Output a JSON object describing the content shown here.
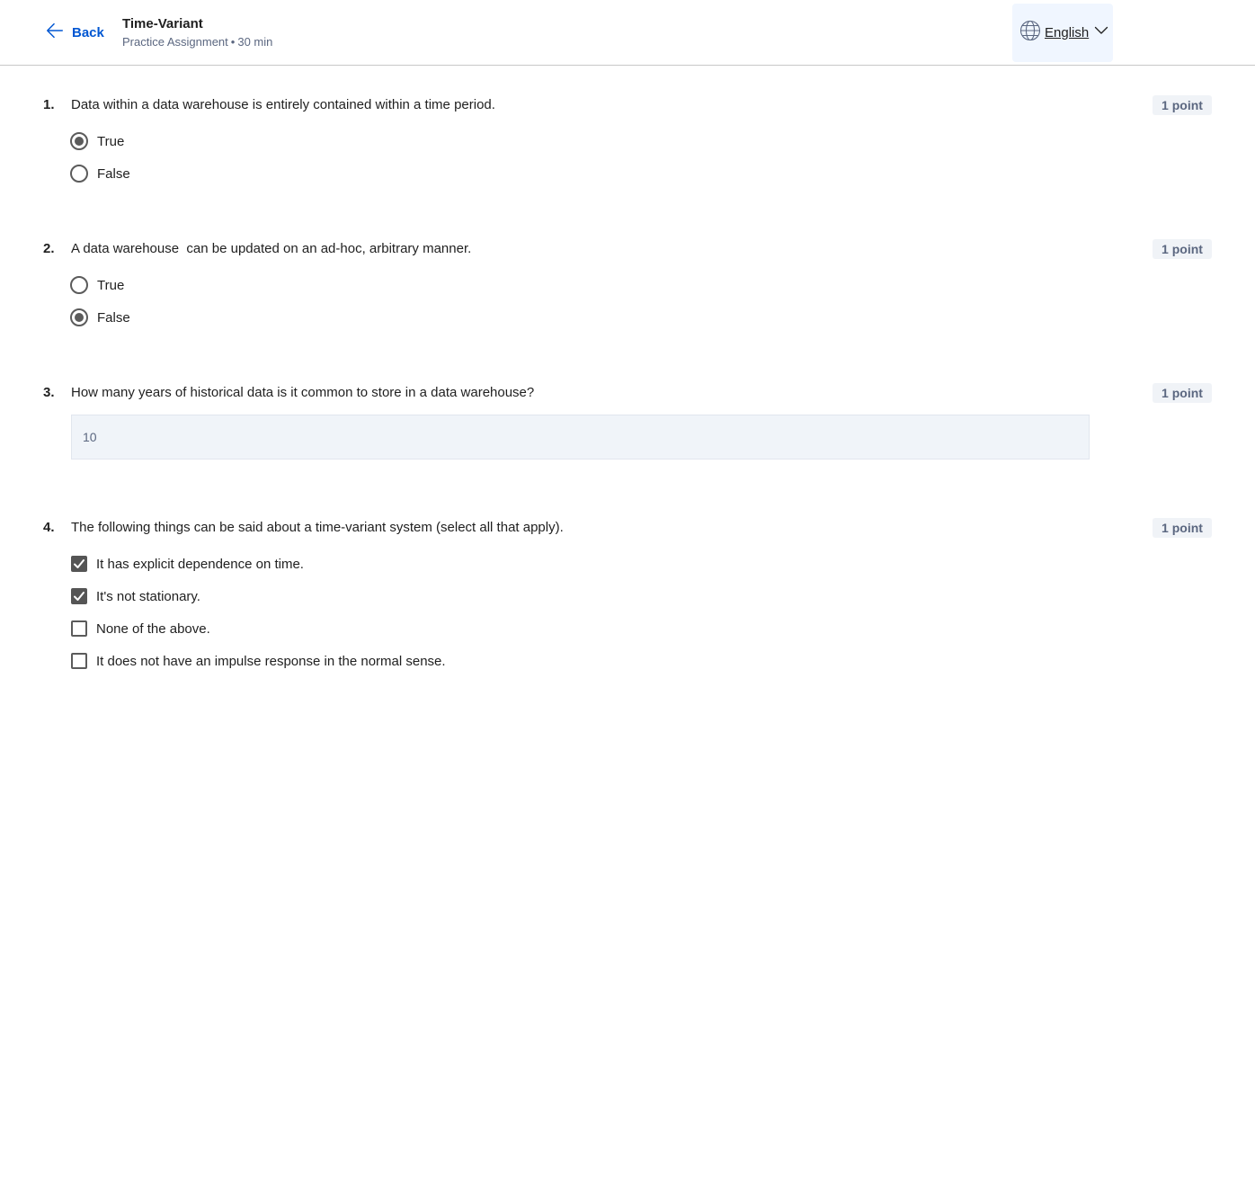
{
  "header": {
    "back_label": "Back",
    "title": "Time-Variant",
    "assignment_type": "Practice Assignment",
    "separator": "•",
    "duration": "30 min",
    "language": "English"
  },
  "questions": [
    {
      "number": "1.",
      "text": "Data within a data warehouse is entirely contained within a time period.",
      "points": "1 point",
      "type": "radio",
      "options": [
        {
          "label": "True",
          "checked": true
        },
        {
          "label": "False",
          "checked": false
        }
      ]
    },
    {
      "number": "2.",
      "text": "A data warehouse  can be updated on an ad-hoc, arbitrary manner.",
      "points": "1 point",
      "type": "radio",
      "options": [
        {
          "label": "True",
          "checked": false
        },
        {
          "label": "False",
          "checked": true
        }
      ]
    },
    {
      "number": "3.",
      "text": "How many years of historical data is it common to store in a data warehouse?",
      "points": "1 point",
      "type": "text",
      "answer": "10"
    },
    {
      "number": "4.",
      "text": "The following things can be said about a time-variant system (select all that apply).",
      "points": "1 point",
      "type": "checkbox",
      "options": [
        {
          "label": "It has explicit dependence on time.",
          "checked": true
        },
        {
          "label": "It's not stationary.",
          "checked": true
        },
        {
          "label": "None of the above.",
          "checked": false
        },
        {
          "label": "It does not have an impulse response in the normal sense.",
          "checked": false
        }
      ]
    }
  ]
}
